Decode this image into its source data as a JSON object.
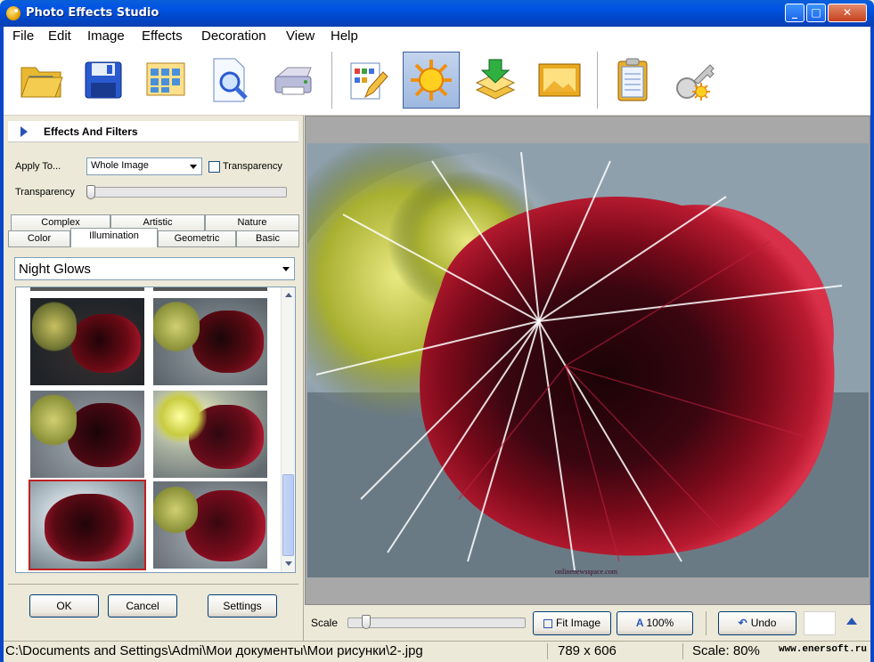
{
  "window": {
    "title": "Photo Effects Studio",
    "controls": {
      "minimize": "_",
      "maximize": "□",
      "close": "✕"
    }
  },
  "menu": [
    "File",
    "Edit",
    "Image",
    "Effects",
    "Decoration",
    "View",
    "Help"
  ],
  "toolbar": {
    "tools": [
      {
        "name": "open-folder-icon",
        "active": false
      },
      {
        "name": "save-disk-icon",
        "active": false
      },
      {
        "name": "grid-calendar-icon",
        "active": false
      },
      {
        "name": "preview-magnifier-icon",
        "active": false
      },
      {
        "name": "printer-icon",
        "active": false
      },
      {
        "name": "edit-pencil-icon",
        "active": false
      },
      {
        "name": "sun-effects-icon",
        "active": true
      },
      {
        "name": "layers-download-icon",
        "active": false
      },
      {
        "name": "picture-frame-icon",
        "active": false
      },
      {
        "name": "clipboard-icon",
        "active": false
      },
      {
        "name": "key-sun-icon",
        "active": false
      }
    ]
  },
  "panel": {
    "title": "Effects And Filters",
    "apply_to_label": "Apply To...",
    "apply_to_value": "Whole Image",
    "transparency_checkbox": "Transparency",
    "transparency_label": "Transparency",
    "tabs_row1": [
      "Complex",
      "Artistic",
      "Nature"
    ],
    "tabs_row2": [
      "Color",
      "Illumination",
      "Geometric",
      "Basic"
    ],
    "active_tab": "Illumination",
    "effect_value": "Night Glows",
    "ok": "OK",
    "cancel": "Cancel",
    "settings": "Settings"
  },
  "controls": {
    "scale_label": "Scale",
    "fit_image": "Fit Image",
    "zoom_100": "100%",
    "undo": "Undo"
  },
  "image": {
    "caption": "onlinenewsspace.com"
  },
  "status": {
    "path": "C:\\Documents and Settings\\Admi\\Мои документы\\Мои рисунки\\2-.jpg",
    "dimensions": "789 x 606",
    "scale": "Scale: 80%",
    "watermark": "www.enersoft.ru"
  },
  "colors": {
    "title_bar": "#0054e3",
    "window_bg": "#ece9d8",
    "rose": "#8a0c18",
    "foliage": "#c8cc40"
  }
}
